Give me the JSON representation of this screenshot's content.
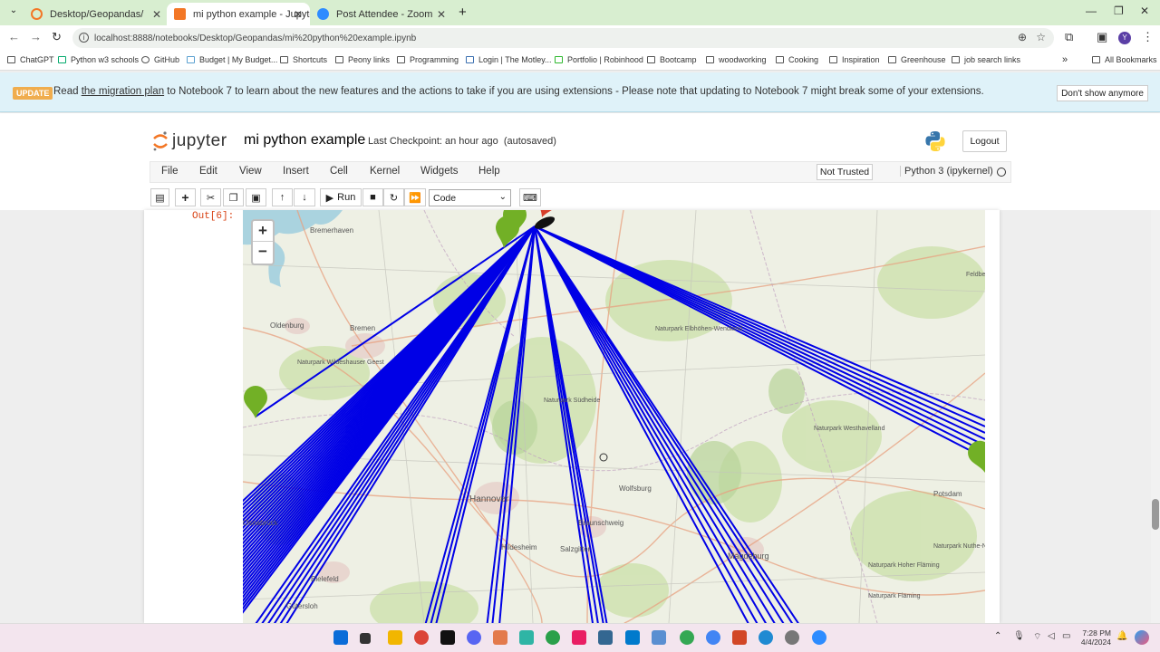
{
  "browser": {
    "tabs": [
      {
        "label": "Desktop/Geopandas/",
        "active": false,
        "color": "#f37726"
      },
      {
        "label": "mi python example - Jupyter N",
        "active": true,
        "color": "#f37726"
      },
      {
        "label": "Post Attendee - Zoom",
        "active": false,
        "color": "#2d8cff"
      }
    ],
    "url": "localhost:8888/notebooks/Desktop/Geopandas/mi%20python%20example.ipynb",
    "bookmarks": [
      "ChatGPT",
      "Python w3 schools",
      "GitHub",
      "Budget | My Budget...",
      "Shortcuts",
      "Peony links",
      "Programming",
      "Login | The Motley...",
      "Portfolio | Robinhood",
      "Bootcamp",
      "woodworking",
      "Cooking",
      "Inspiration",
      "Greenhouse",
      "job search links"
    ],
    "all_bookmarks": "All Bookmarks"
  },
  "banner": {
    "badge": "UPDATE",
    "text_before": "Read ",
    "link": "the migration plan",
    "text_after": " to Notebook 7 to learn about the new features and the actions to take if you are using extensions - Please note that updating to Notebook 7 might break some of your extensions.",
    "dismiss": "Don't show anymore"
  },
  "header": {
    "logo_text": "jupyter",
    "notebook_name": "mi python example",
    "checkpoint": "Last Checkpoint: an hour ago",
    "autosaved": "(autosaved)",
    "logout": "Logout"
  },
  "menu": {
    "items": [
      "File",
      "Edit",
      "View",
      "Insert",
      "Cell",
      "Kernel",
      "Widgets",
      "Help"
    ],
    "trust": "Not Trusted",
    "kernel": "Python 3 (ipykernel)"
  },
  "toolbar": {
    "run": "Run",
    "cell_type": "Code"
  },
  "cell": {
    "prompt": "Out[6]:"
  },
  "map": {
    "zoom_in": "+",
    "zoom_out": "−",
    "place_labels": [
      "Bremerhaven",
      "Oldenburg",
      "Bremen",
      "Naturpark Wildeshauser Geest",
      "Naturpark Elbhöhen-Wendland",
      "Naturpark Südheide",
      "Naturpark Westhavelland",
      "Hannover",
      "Wolfsburg",
      "Braunschweig",
      "Hildesheim",
      "Salzgitter",
      "Magdeburg",
      "Potsdam",
      "Bielefeld",
      "Gütersloh",
      "Osnabrück",
      "Naturpark Nuthe-Nieplitz",
      "Naturpark Hoher Fläming",
      "Naturpark Fläming",
      "Feldberger Seen"
    ],
    "line_color": "#0000e6",
    "marker_color": "#72b026",
    "origin_color": "#d63e2a"
  },
  "taskbar": {
    "time": "7:28 PM",
    "date": "4/4/2024"
  }
}
